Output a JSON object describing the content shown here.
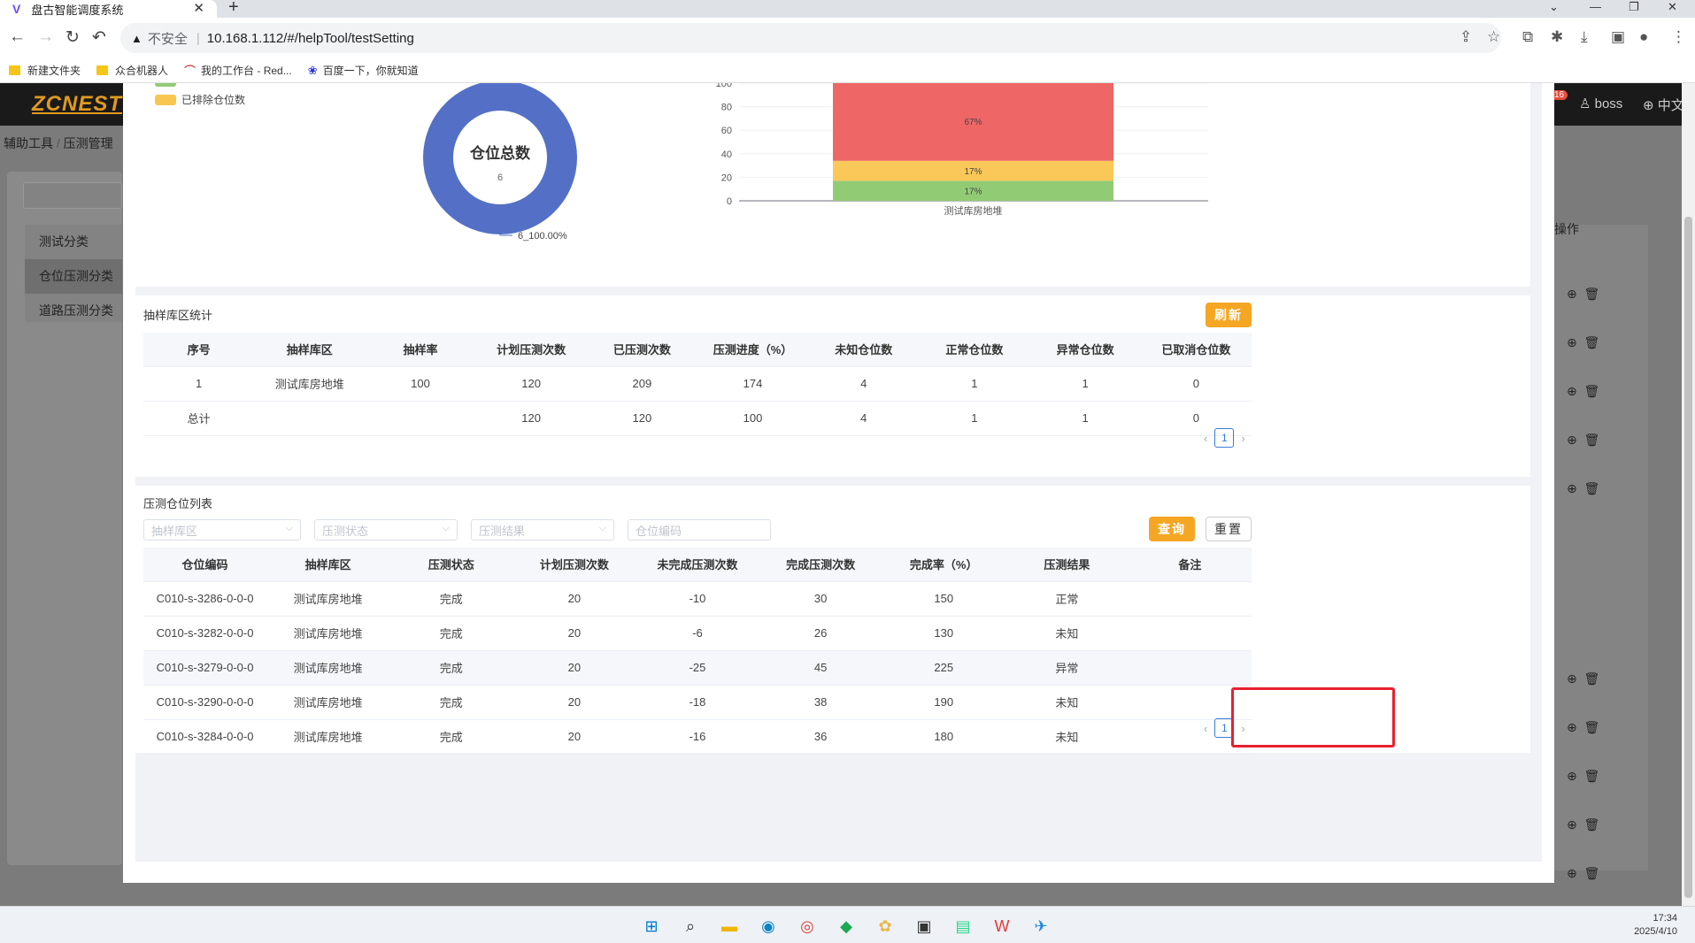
{
  "browser": {
    "tab_title": "盘古智能调度系统",
    "tab_close": "✕",
    "new_tab": "+",
    "insecure_label": "不安全",
    "url": "10.168.1.112/#/helpTool/testSetting",
    "bookmarks": [
      {
        "label": "新建文件夹",
        "icon": "folder-icon"
      },
      {
        "label": "众合机器人",
        "icon": "folder-icon"
      },
      {
        "label": "我的工作台 - Red...",
        "icon": "redmine-icon"
      },
      {
        "label": "百度一下，你就知道",
        "icon": "baidu-icon"
      }
    ]
  },
  "app": {
    "logo": "ZCNEST",
    "notif_count": "16",
    "user": "boss",
    "lang": "中文",
    "breadcrumb": [
      "辅助工具",
      "压测管理"
    ],
    "left_menu": [
      "测试分类",
      "仓位压测分类",
      "道路压测分类"
    ],
    "op_header": "操作"
  },
  "chart_section": {
    "legend": [
      {
        "label": "已排除仓位数",
        "color": "#f9c74f"
      }
    ],
    "donut": {
      "center_title": "仓位总数",
      "center_value": "6",
      "label": "6_100.00%",
      "color": "#5470c6"
    }
  },
  "chart_data": {
    "type": "bar",
    "stacked": true,
    "categories": [
      "测试库房地堆"
    ],
    "series": [
      {
        "values": [
          17
        ],
        "color": "#91cc75",
        "label": "17%"
      },
      {
        "values": [
          17
        ],
        "color": "#fac858",
        "label": "17%"
      },
      {
        "values": [
          67
        ],
        "color": "#ee6666",
        "label": "67%"
      }
    ],
    "yticks": [
      "0",
      "20",
      "40",
      "60",
      "80",
      "100"
    ],
    "ylim": [
      0,
      100
    ]
  },
  "sample_section": {
    "title": "抽样库区统计",
    "refresh_label": "刷新",
    "columns": [
      "序号",
      "抽样库区",
      "抽样率",
      "计划压测次数",
      "已压测次数",
      "压测进度（%）",
      "未知仓位数",
      "正常仓位数",
      "异常仓位数",
      "已取消仓位数"
    ],
    "rows": [
      [
        "1",
        "测试库房地堆",
        "100",
        "120",
        "209",
        "174",
        "4",
        "1",
        "1",
        "0"
      ],
      [
        "总计",
        "",
        "",
        "120",
        "120",
        "100",
        "4",
        "1",
        "1",
        "0"
      ]
    ],
    "page": "1"
  },
  "list_section": {
    "title": "压测仓位列表",
    "filters": {
      "area_placeholder": "抽样库区",
      "status_placeholder": "压测状态",
      "result_placeholder": "压测结果",
      "code_placeholder": "仓位编码"
    },
    "query_label": "查询",
    "reset_label": "重置",
    "columns": [
      "仓位编码",
      "抽样库区",
      "压测状态",
      "计划压测次数",
      "未完成压测次数",
      "完成压测次数",
      "完成率（%）",
      "压测结果",
      "备注"
    ],
    "rows": [
      [
        "C010-s-3286-0-0-0",
        "测试库房地堆",
        "完成",
        "20",
        "-10",
        "30",
        "150",
        "正常",
        ""
      ],
      [
        "C010-s-3282-0-0-0",
        "测试库房地堆",
        "完成",
        "20",
        "-6",
        "26",
        "130",
        "未知",
        ""
      ],
      [
        "C010-s-3279-0-0-0",
        "测试库房地堆",
        "完成",
        "20",
        "-25",
        "45",
        "225",
        "异常",
        ""
      ],
      [
        "C010-s-3290-0-0-0",
        "测试库房地堆",
        "完成",
        "20",
        "-18",
        "38",
        "190",
        "未知",
        ""
      ],
      [
        "C010-s-3284-0-0-0",
        "测试库房地堆",
        "完成",
        "20",
        "-16",
        "36",
        "180",
        "未知",
        ""
      ]
    ],
    "page": "1"
  },
  "taskbar": {
    "time": "17:34",
    "date": "2025/4/10"
  }
}
